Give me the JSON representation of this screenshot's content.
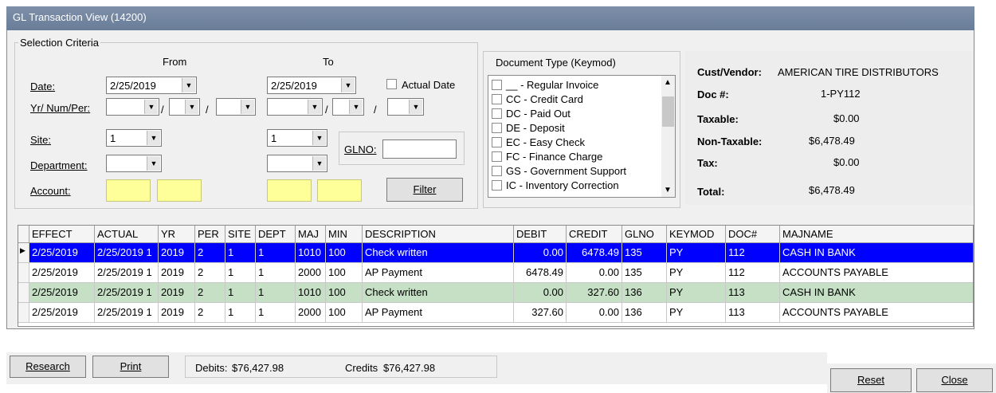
{
  "window": {
    "title": "GL Transaction View (14200)"
  },
  "selection": {
    "legend": "Selection Criteria",
    "from_label": "From",
    "to_label": "To",
    "date_label": "Date:",
    "date_from": "2/25/2019",
    "date_to": "2/25/2019",
    "actual_date_label": "Actual Date",
    "yr_num_per_label": "Yr/ Num/Per:",
    "slash": "/",
    "site_label": "Site:",
    "site_from": "1",
    "site_to": "1",
    "department_label": "Department:",
    "glno_label": "GLNO:",
    "account_label": "Account:",
    "filter_label": "Filter"
  },
  "document_type": {
    "title": "Document Type (Keymod)",
    "items": [
      "__ - Regular Invoice",
      "CC - Credit Card",
      "DC - Paid Out",
      "DE - Deposit",
      "EC - Easy Check",
      "FC - Finance Charge",
      "GS - Government Support",
      "IC - Inventory Correction"
    ]
  },
  "summary": {
    "cust_vendor_label": "Cust/Vendor:",
    "cust_vendor": "AMERICAN TIRE DISTRIBUTORS",
    "doc_label": "Doc #:",
    "doc": "1-PY112",
    "taxable_label": "Taxable:",
    "taxable": "$0.00",
    "non_taxable_label": "Non-Taxable:",
    "non_taxable": "$6,478.49",
    "tax_label": "Tax:",
    "tax": "$0.00",
    "total_label": "Total:",
    "total": "$6,478.49"
  },
  "grid": {
    "columns": [
      "EFFECT",
      "ACTUAL",
      "YR",
      "PER",
      "SITE",
      "DEPT",
      "MAJ",
      "MIN",
      "DESCRIPTION",
      "DEBIT",
      "CREDIT",
      "GLNO",
      "KEYMOD",
      "DOC#",
      "MAJNAME"
    ],
    "rows": [
      [
        "2/25/2019",
        "2/25/2019 1",
        "2019",
        "2",
        "1",
        "1",
        "1010",
        "100",
        "Check written",
        "0.00",
        "6478.49",
        "135",
        "PY",
        "112",
        "CASH IN BANK"
      ],
      [
        "2/25/2019",
        "2/25/2019 1",
        "2019",
        "2",
        "1",
        "1",
        "2000",
        "100",
        "AP Payment",
        "6478.49",
        "0.00",
        "135",
        "PY",
        "112",
        "ACCOUNTS PAYABLE"
      ],
      [
        "2/25/2019",
        "2/25/2019 1",
        "2019",
        "2",
        "1",
        "1",
        "1010",
        "100",
        "Check written",
        "0.00",
        "327.60",
        "136",
        "PY",
        "113",
        "CASH IN BANK"
      ],
      [
        "2/25/2019",
        "2/25/2019 1",
        "2019",
        "2",
        "1",
        "1",
        "2000",
        "100",
        "AP Payment",
        "327.60",
        "0.00",
        "136",
        "PY",
        "113",
        "ACCOUNTS PAYABLE"
      ]
    ]
  },
  "footer": {
    "research_label": "Research",
    "print_label": "Print",
    "debits_label": "Debits:",
    "debits": "$76,427.98",
    "credits_label": "Credits",
    "credits": "$76,427.98",
    "reset_label": "Reset",
    "close_label": "Close"
  },
  "colors": {
    "selected_row": "#0000ff",
    "alt_row": "#c6e0c6",
    "yellow_field": "#ffff99",
    "titlebar": "#7286a2"
  }
}
